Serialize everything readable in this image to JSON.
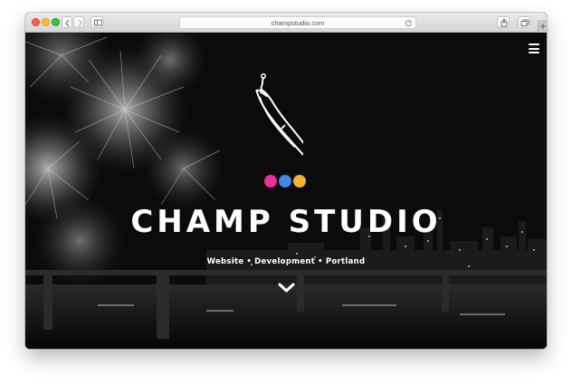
{
  "browser": {
    "address": "champstudio.com",
    "icons": [
      "back-icon",
      "forward-icon",
      "sidebar-icon",
      "reload-icon",
      "share-icon",
      "tabs-icon",
      "new-tab-icon"
    ]
  },
  "hero": {
    "title": "CHAMP STUDIO",
    "subtitle_parts": [
      "Website",
      "Development",
      "Portland"
    ],
    "separator": "•",
    "logo_icon": "banana-logo-icon",
    "dots": [
      {
        "name": "magenta-dot",
        "color": "#ea2e9a"
      },
      {
        "name": "blue-dot",
        "color": "#3f88e4"
      },
      {
        "name": "yellow-dot",
        "color": "#f4b331"
      }
    ]
  },
  "colors": {
    "background": "#0b0b0b",
    "text": "#ffffff"
  }
}
